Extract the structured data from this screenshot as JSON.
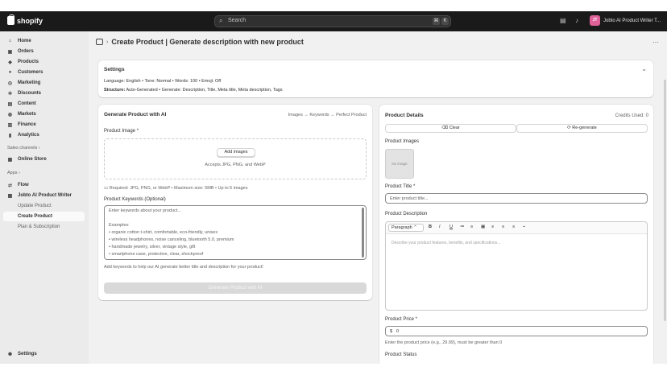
{
  "topbar": {
    "brand": "shopify",
    "search_placeholder": "Search",
    "shortcut_key1": "⌘",
    "shortcut_key2": "K",
    "user_initials": "JT",
    "user_name": "Jobto AI Product Writer T..."
  },
  "sidebar": {
    "items": [
      {
        "label": "Home",
        "icon": "home-icon",
        "glyph": "⌂"
      },
      {
        "label": "Orders",
        "icon": "orders-icon",
        "glyph": "▣"
      },
      {
        "label": "Products",
        "icon": "tag-icon",
        "glyph": "◆"
      },
      {
        "label": "Customers",
        "icon": "person-icon",
        "glyph": "●"
      },
      {
        "label": "Marketing",
        "icon": "target-icon",
        "glyph": "◎"
      },
      {
        "label": "Discounts",
        "icon": "discount-icon",
        "glyph": "✲"
      },
      {
        "label": "Content",
        "icon": "content-icon",
        "glyph": "▤"
      },
      {
        "label": "Markets",
        "icon": "globe-icon",
        "glyph": "◍"
      },
      {
        "label": "Finance",
        "icon": "bank-icon",
        "glyph": "▥"
      },
      {
        "label": "Analytics",
        "icon": "chart-icon",
        "glyph": "▮"
      }
    ],
    "sales_channels_label": "Sales channels ›",
    "online_store": "Online Store",
    "apps_label": "Apps ›",
    "flow": "Flow",
    "app_name": "Jobto AI Product Writer",
    "update_product": "Update Product",
    "create_product": "Create Product",
    "plan": "Plan & Subscription",
    "settings": "Settings"
  },
  "page": {
    "title": "Create Product | Generate description with new product",
    "more": "···"
  },
  "settings_card": {
    "title": "Settings",
    "line1": "Language: English • Tone: Normal • Words: 100 • Emoji: Off",
    "line2_label": "Structure:",
    "line2_value": " Auto-Generated • Generate: Description, Title, Meta title, Meta description, Tags"
  },
  "generate_card": {
    "title": "Generate Product with AI",
    "steps": "Images → Keywords → Perfect Product",
    "image_label": "Product Image *",
    "add_images": "Add images",
    "accepts": "Accepts JPG, PNG, and WebP",
    "requirements": "▭ Required: JPG, PNG, or WebP • Maximum size: 5MB • Up to 5 images",
    "keywords_label": "Product Keywords (Optional)",
    "keywords_placeholder": [
      "Enter keywords about your product...",
      "",
      "Examples:",
      "• organic cotton t-shirt, comfortable, eco-friendly, unisex",
      "• wireless headphones, noise canceling, bluetooth 5.0, premium",
      "• handmade jewelry, silver, vintage style, gift",
      "• smartphone case, protective, clear, shockproof"
    ],
    "keywords_help": "Add keywords to help our AI generate better title and description for your product!",
    "generate_button": "Generate Product with AI"
  },
  "details_card": {
    "title": "Product Details",
    "credits": "Credits Used: 0",
    "clear": "Clear",
    "regenerate": "Re-generate",
    "images_label": "Product Images",
    "no_image": "No image",
    "title_label": "Product Title *",
    "title_placeholder": "Enter product title...",
    "description_label": "Product Description",
    "paragraph": "Paragraph",
    "toolbar": [
      "B",
      "I",
      "U",
      "≔",
      "≡",
      "▦",
      "≡",
      "≡",
      "≡",
      "⌁"
    ],
    "description_placeholder": "Describe your product features, benefits, and specifications...",
    "price_label": "Product Price *",
    "currency": "$",
    "price_value": "0",
    "price_help": "Enter the product price (e.g., 29.99), must be greater than 0",
    "status_label": "Product Status"
  }
}
